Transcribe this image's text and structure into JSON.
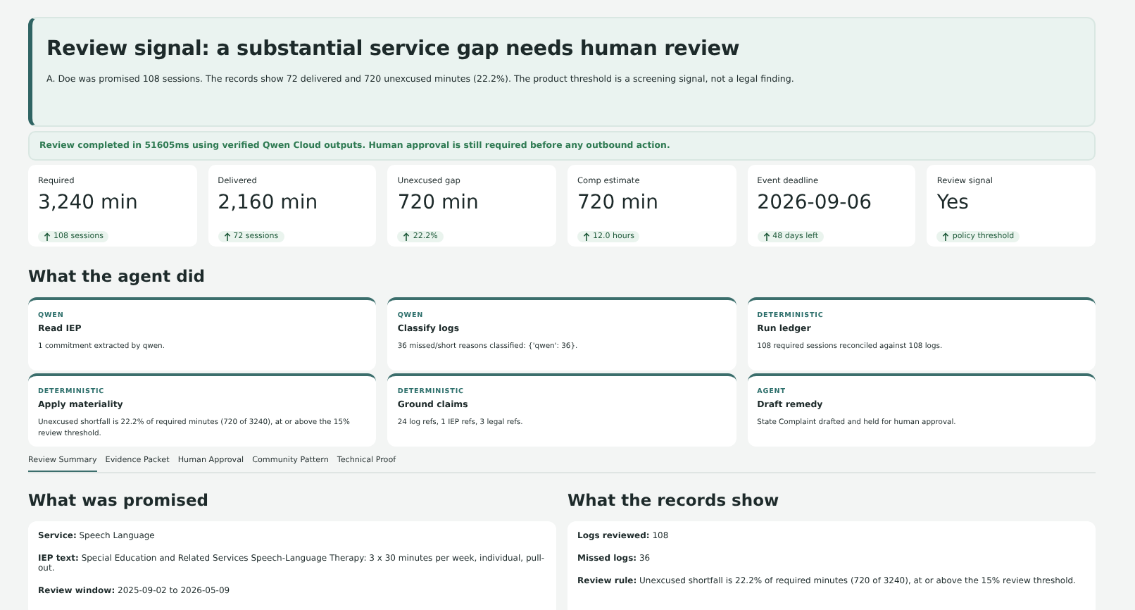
{
  "hero": {
    "title": "Review signal: a substantial service gap needs human review",
    "summary": "A. Doe was promised 108 sessions. The records show 72 delivered and 720 unexcused minutes (22.2%). The product threshold is a screening signal, not a legal finding."
  },
  "notice": "Review completed in 51605ms using verified Qwen Cloud outputs. Human approval is still required before any outbound action.",
  "metrics": [
    {
      "label": "Required",
      "value": "3,240 min",
      "delta": "108 sessions"
    },
    {
      "label": "Delivered",
      "value": "2,160 min",
      "delta": "72 sessions"
    },
    {
      "label": "Unexcused gap",
      "value": "720 min",
      "delta": "22.2%"
    },
    {
      "label": "Comp estimate",
      "value": "720 min",
      "delta": "12.0 hours"
    },
    {
      "label": "Event deadline",
      "value": "2026-09-06",
      "delta": "48 days left"
    },
    {
      "label": "Review signal",
      "value": "Yes",
      "delta": "policy threshold"
    }
  ],
  "agent_section": {
    "heading": "What the agent did",
    "steps": [
      {
        "source": "QWEN",
        "title": "Read IEP",
        "detail": "1 commitment extracted by qwen."
      },
      {
        "source": "QWEN",
        "title": "Classify logs",
        "detail": "36 missed/short reasons classified: {'qwen': 36}."
      },
      {
        "source": "DETERMINISTIC",
        "title": "Run ledger",
        "detail": "108 required sessions reconciled against 108 logs."
      },
      {
        "source": "DETERMINISTIC",
        "title": "Apply materiality",
        "detail": "Unexcused shortfall is 22.2% of required minutes (720 of 3240), at or above the 15% review threshold."
      },
      {
        "source": "DETERMINISTIC",
        "title": "Ground claims",
        "detail": "24 log refs, 1 IEP refs, 3 legal refs."
      },
      {
        "source": "AGENT",
        "title": "Draft remedy",
        "detail": "State Complaint drafted and held for human approval."
      }
    ]
  },
  "tabs": [
    {
      "label": "Review Summary",
      "selected": true
    },
    {
      "label": "Evidence Packet",
      "selected": false
    },
    {
      "label": "Human Approval",
      "selected": false
    },
    {
      "label": "Community Pattern",
      "selected": false
    },
    {
      "label": "Technical Proof",
      "selected": false
    }
  ],
  "panels": [
    {
      "heading": "What was promised",
      "lines": [
        "**Service:** Speech Language",
        "**IEP text:** Special Education and Related Services Speech-Language Therapy: 3 x 30 minutes per week, individual, pull-out.",
        "**Review window:** 2025-09-02 to 2026-05-09"
      ]
    },
    {
      "heading": "What the records show",
      "lines": [
        "**Logs reviewed:** 108",
        "**Missed logs:** 36",
        "**Review rule:** Unexcused shortfall is 22.2% of required minutes (720 of 3240), at or above the 15% review threshold."
      ]
    }
  ]
}
